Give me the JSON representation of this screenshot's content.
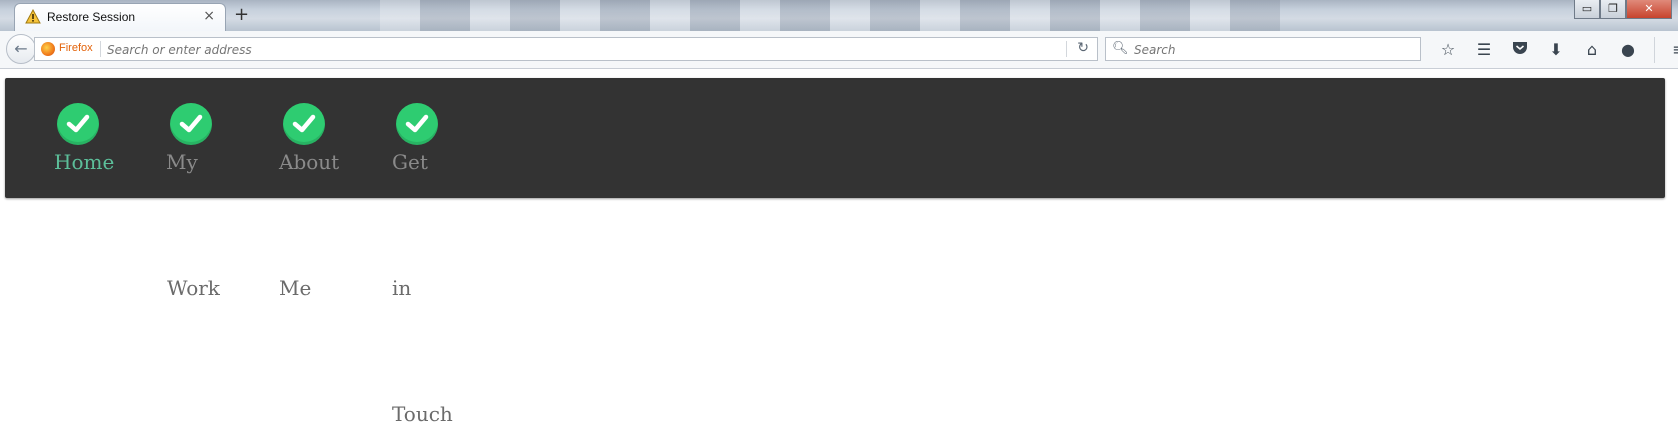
{
  "browser": {
    "tab_title": "Restore Session",
    "tab_close_glyph": "×",
    "new_tab_glyph": "+",
    "window_buttons": {
      "minimize": "▭",
      "restore": "❐",
      "close": "✕"
    },
    "url_brand": "Firefox",
    "url_placeholder": "Search or enter address",
    "search_placeholder": "Search",
    "toolbar_icons": [
      "bookmark-star-icon",
      "reading-list-icon",
      "pocket-icon",
      "download-icon",
      "home-icon",
      "chat-icon",
      "menu-icon"
    ]
  },
  "site_nav": {
    "background": "#333333",
    "check_color": "#2ecc71",
    "active_color": "#5cbf9a",
    "items": [
      {
        "label_lines": [
          "Home"
        ],
        "active": true
      },
      {
        "label_lines": [
          "My",
          "Work"
        ],
        "active": false
      },
      {
        "label_lines": [
          "About",
          "Me"
        ],
        "active": false
      },
      {
        "label_lines": [
          "Get",
          "in",
          "Touch"
        ],
        "active": false
      }
    ]
  }
}
